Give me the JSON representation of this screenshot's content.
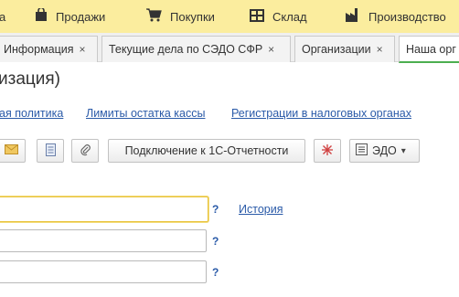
{
  "menu": {
    "items": [
      {
        "label": "а",
        "icon": "partial-icon"
      },
      {
        "label": "Продажи",
        "icon": "bag-icon"
      },
      {
        "label": "Покупки",
        "icon": "cart-icon"
      },
      {
        "label": "Склад",
        "icon": "warehouse-icon"
      },
      {
        "label": "Производство",
        "icon": "factory-icon"
      }
    ]
  },
  "tabs": [
    {
      "label": "Информация",
      "close": "×"
    },
    {
      "label": "Текущие дела по СЭДО СФР",
      "close": "×"
    },
    {
      "label": "Организации",
      "close": "×"
    },
    {
      "label": "Наша орг",
      "close": ""
    }
  ],
  "page": {
    "title": "изация)"
  },
  "links": [
    "ая политика",
    "Лимиты остатка кассы",
    "Регистрации в налоговых органах"
  ],
  "toolbar": {
    "connect_label": "Подключение к 1С-Отчетности",
    "edo_label": "ЭДО",
    "dropdown_glyph": "▾"
  },
  "form": {
    "help_glyph": "?",
    "history_label": "История"
  },
  "colors": {
    "menubar": "#fbed9e",
    "link": "#2a5aa8",
    "active_tab_underline": "#4caf50",
    "focus_border": "#e8c23a"
  }
}
